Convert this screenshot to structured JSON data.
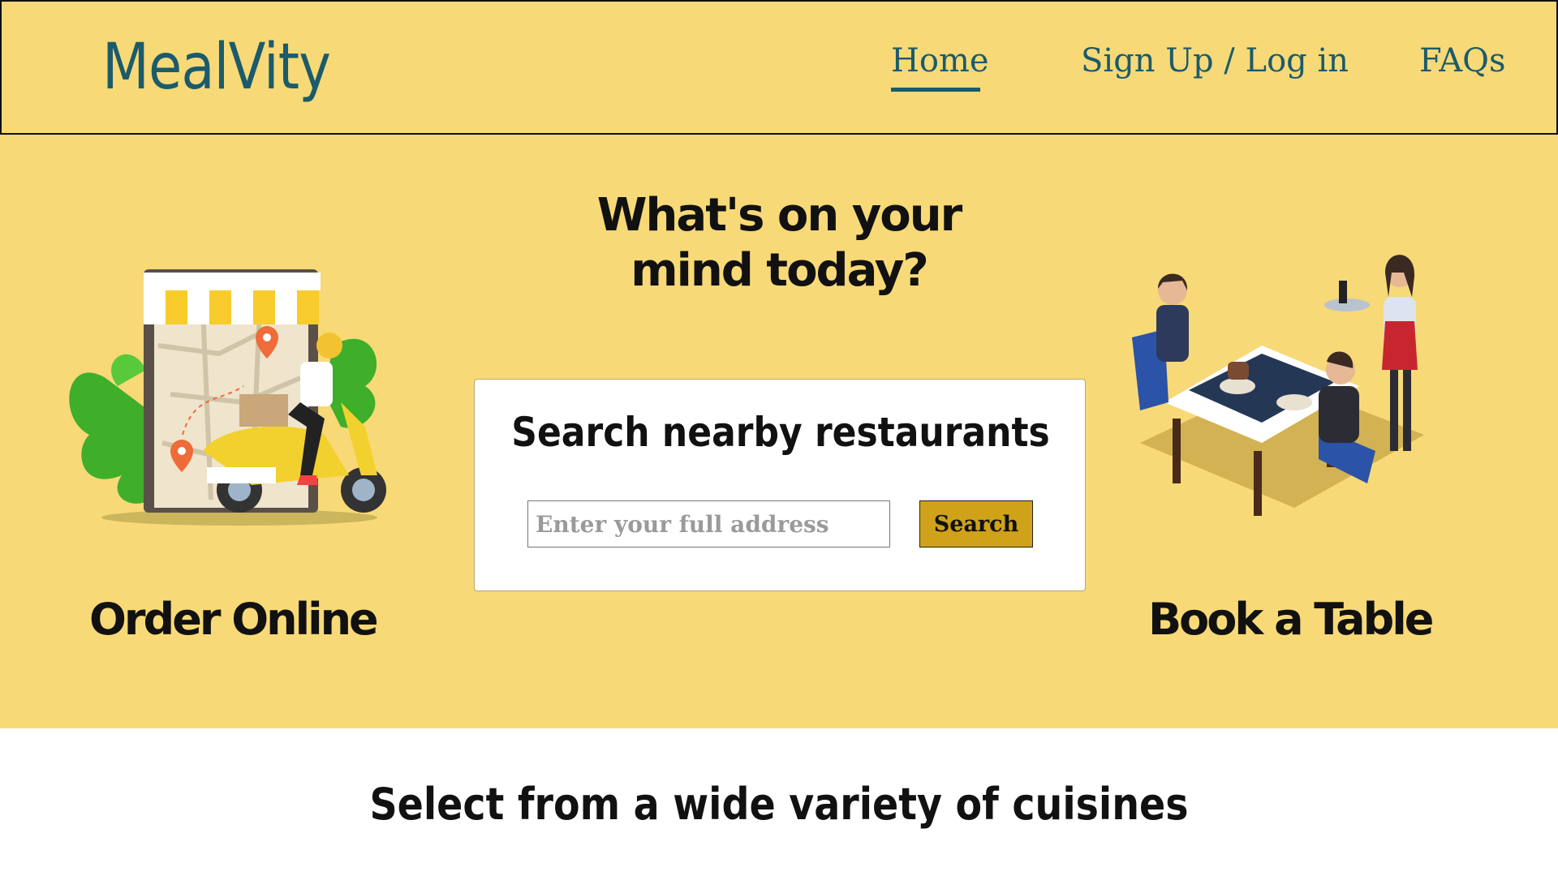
{
  "header": {
    "brand": "MealVity",
    "nav": {
      "home": "Home",
      "signup": "Sign Up / Log in",
      "faqs": "FAQs"
    },
    "active": "Home"
  },
  "hero": {
    "title_line1": "What's on your",
    "title_line2": "mind today?",
    "search": {
      "title": "Search nearby restaurants",
      "placeholder": "Enter your full address",
      "button": "Search"
    },
    "order_label": "Order Online",
    "book_label": "Book a Table"
  },
  "cuisines": {
    "title": "Select from a wide variety of cuisines"
  },
  "colors": {
    "brand_yellow": "#f7d977",
    "brand_teal": "#1b5b6b",
    "search_button": "#cfa21a"
  },
  "icons": {
    "left_illustration": "delivery-scooter-illustration",
    "right_illustration": "restaurant-table-illustration"
  }
}
